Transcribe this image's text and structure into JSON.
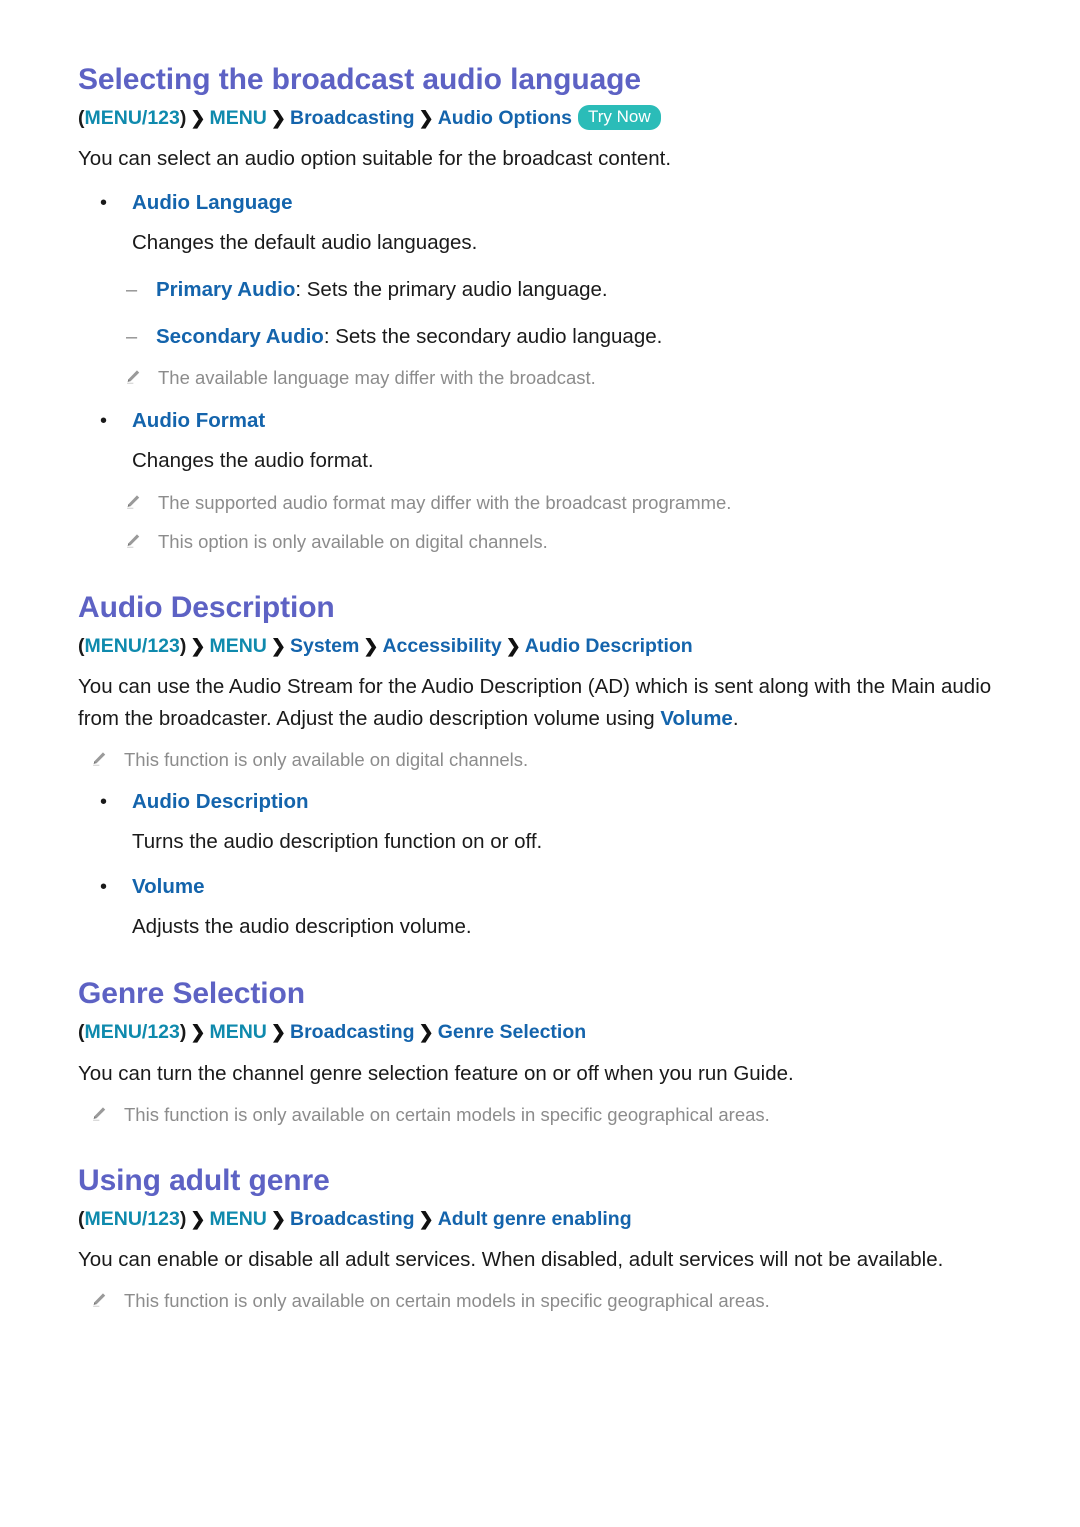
{
  "colors": {
    "heading": "#5d62c4",
    "link": "#1464ac",
    "menu_token": "#0f8aad",
    "badge_bg": "#2bbcb8",
    "badge_text": "#ffffff",
    "note_text": "#8c8c8c",
    "body_text": "#1a1a1a"
  },
  "sections": [
    {
      "id": "selecting-broadcast-audio-language",
      "title": "Selecting the broadcast audio language",
      "breadcrumb": {
        "open_paren": "(",
        "menu123": "MENU/123",
        "close_paren": ")",
        "separator": "❯",
        "menu": "MENU",
        "items": [
          "Broadcasting",
          "Audio Options"
        ],
        "badge": "Try Now"
      },
      "intro": "You can select an audio option suitable for the broadcast content.",
      "bullets": [
        {
          "marker": "•",
          "label": "Audio Language",
          "desc": "Changes the default audio languages.",
          "subitems": [
            {
              "marker": "–",
              "label": "Primary Audio",
              "text": ": Sets the primary audio language."
            },
            {
              "marker": "–",
              "label": "Secondary Audio",
              "text": ": Sets the secondary audio language."
            }
          ],
          "notes": [
            "The available language may differ with the broadcast."
          ]
        },
        {
          "marker": "•",
          "label": "Audio Format",
          "desc": "Changes the audio format.",
          "subitems": [],
          "notes": [
            "The supported audio format may differ with the broadcast programme.",
            "This option is only available on digital channels."
          ]
        }
      ]
    },
    {
      "id": "audio-description",
      "title": "Audio Description",
      "breadcrumb": {
        "open_paren": "(",
        "menu123": "MENU/123",
        "close_paren": ")",
        "separator": "❯",
        "menu": "MENU",
        "items": [
          "System",
          "Accessibility",
          "Audio Description"
        ],
        "badge": ""
      },
      "intro_parts": {
        "before": "You can use the Audio Stream for the Audio Description (AD) which is sent along with the Main audio from the broadcaster. Adjust the audio description volume using ",
        "link": "Volume",
        "after": "."
      },
      "top_notes": [
        "This function is only available on digital channels."
      ],
      "bullets": [
        {
          "marker": "•",
          "label": "Audio Description",
          "desc": "Turns the audio description function on or off.",
          "subitems": [],
          "notes": []
        },
        {
          "marker": "•",
          "label": "Volume",
          "desc": "Adjusts the audio description volume.",
          "subitems": [],
          "notes": []
        }
      ]
    },
    {
      "id": "genre-selection",
      "title": "Genre Selection",
      "breadcrumb": {
        "open_paren": "(",
        "menu123": "MENU/123",
        "close_paren": ")",
        "separator": "❯",
        "menu": "MENU",
        "items": [
          "Broadcasting",
          "Genre Selection"
        ],
        "badge": ""
      },
      "intro": "You can turn the channel genre selection feature on or off when you run Guide.",
      "top_notes": [
        "This function is only available on certain models in specific geographical areas."
      ],
      "bullets": []
    },
    {
      "id": "using-adult-genre",
      "title": "Using adult genre",
      "breadcrumb": {
        "open_paren": "(",
        "menu123": "MENU/123",
        "close_paren": ")",
        "separator": "❯",
        "menu": "MENU",
        "items": [
          "Broadcasting",
          "Adult genre enabling"
        ],
        "badge": ""
      },
      "intro": "You can enable or disable all adult services. When disabled, adult services will not be available.",
      "top_notes": [
        "This function is only available on certain models in specific geographical areas."
      ],
      "bullets": []
    }
  ],
  "icons": {
    "note": "pencil-icon"
  }
}
